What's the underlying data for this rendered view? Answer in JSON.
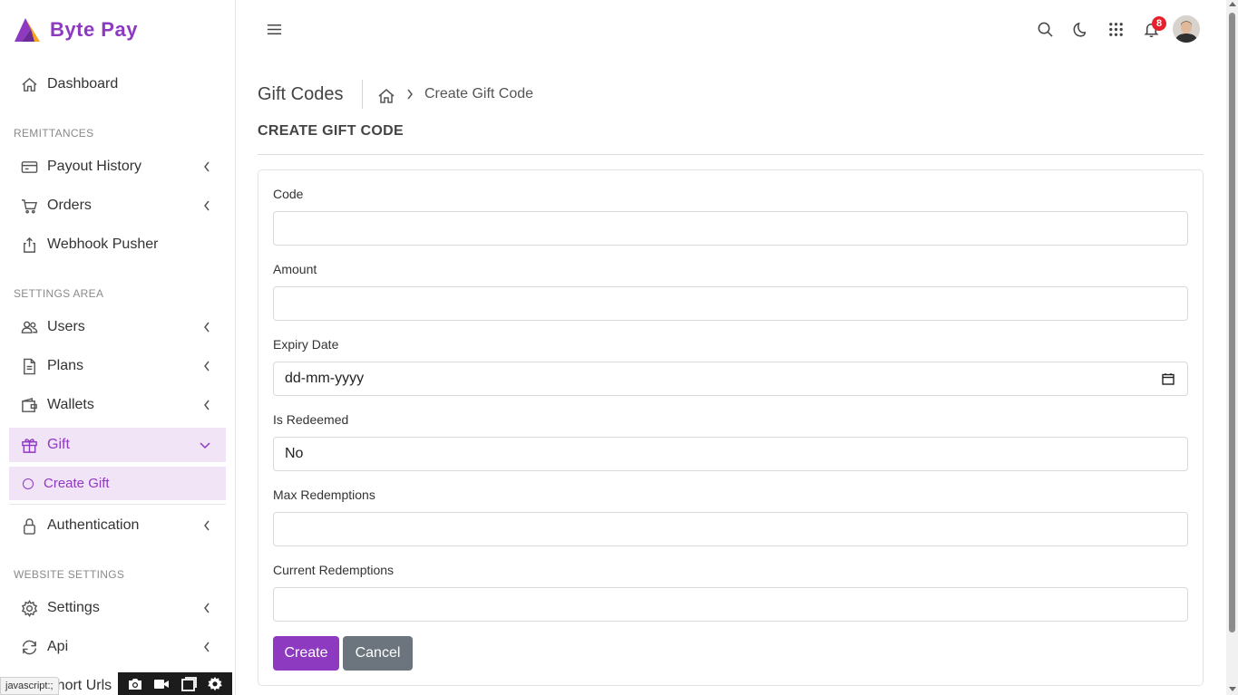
{
  "brand": {
    "name": "Byte Pay"
  },
  "sidebar": {
    "dashboard": "Dashboard",
    "sections": {
      "remittances": "REMITTANCES",
      "settings_area": "SETTINGS AREA",
      "website_settings": "WEBSITE SETTINGS"
    },
    "items": {
      "payout_history": "Payout History",
      "orders": "Orders",
      "webhook_pusher": "Webhook Pusher",
      "users": "Users",
      "plans": "Plans",
      "wallets": "Wallets",
      "gift": "Gift",
      "create_gift": "Create Gift",
      "authentication": "Authentication",
      "settings": "Settings",
      "api": "Api",
      "short_urls": "Short Urls"
    }
  },
  "header": {
    "notification_count": "8"
  },
  "breadcrumb": {
    "page_title": "Gift Codes",
    "current": "Create Gift Code"
  },
  "form": {
    "heading": "CREATE GIFT CODE",
    "code_label": "Code",
    "amount_label": "Amount",
    "expiry_label": "Expiry Date",
    "expiry_placeholder": "dd-mm-yyyy",
    "redeemed_label": "Is Redeemed",
    "redeemed_value": "No",
    "max_label": "Max Redemptions",
    "current_label": "Current Redemptions",
    "create_button": "Create",
    "cancel_button": "Cancel"
  },
  "status_bar": {
    "text": "javascript:;"
  },
  "colors": {
    "accent": "#8e3ac0",
    "accent_light": "#f1e4f7",
    "cancel": "#6c757d",
    "badge": "#e6212c"
  }
}
